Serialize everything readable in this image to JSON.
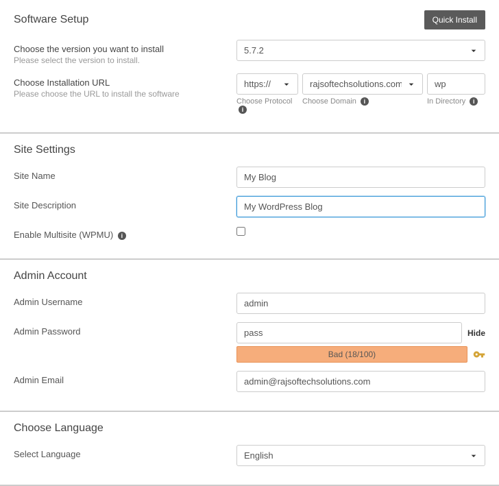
{
  "softwareSetup": {
    "title": "Software Setup",
    "quickInstall": "Quick Install",
    "version": {
      "label": "Choose the version you want to install",
      "subLabel": "Please select the version to install.",
      "value": "5.7.2"
    },
    "url": {
      "label": "Choose Installation URL",
      "subLabel": "Please choose the URL to install the software",
      "protocol": "https://",
      "domain": "rajsoftechsolutions.com",
      "directory": "wp",
      "protocolLabel": "Choose Protocol",
      "domainLabel": "Choose Domain",
      "directoryLabel": "In Directory"
    }
  },
  "siteSettings": {
    "title": "Site Settings",
    "siteName": {
      "label": "Site Name",
      "value": "My Blog"
    },
    "siteDescription": {
      "label": "Site Description",
      "value": "My WordPress Blog"
    },
    "multisite": {
      "label": "Enable Multisite (WPMU)"
    }
  },
  "adminAccount": {
    "title": "Admin Account",
    "username": {
      "label": "Admin Username",
      "value": "admin"
    },
    "password": {
      "label": "Admin Password",
      "value": "pass",
      "hideLabel": "Hide",
      "strength": "Bad (18/100)"
    },
    "email": {
      "label": "Admin Email",
      "value": "admin@rajsoftechsolutions.com"
    }
  },
  "language": {
    "title": "Choose Language",
    "select": {
      "label": "Select Language",
      "value": "English"
    }
  }
}
